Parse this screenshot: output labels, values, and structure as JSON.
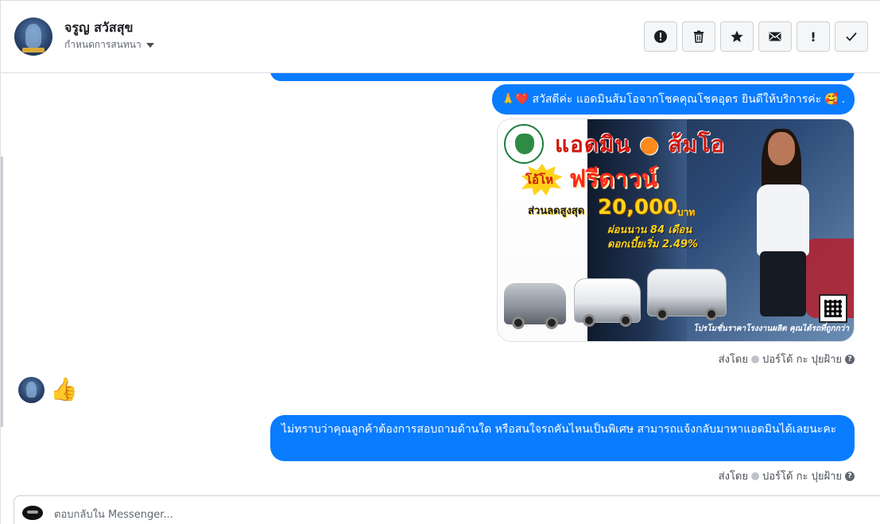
{
  "header": {
    "contact_name": "จรูญ สวัสสุข",
    "assign_label": "กำหนดการสนทนา",
    "actions": [
      {
        "icon": "alert-icon"
      },
      {
        "icon": "trash-icon"
      },
      {
        "icon": "star-icon"
      },
      {
        "icon": "envelope-icon"
      },
      {
        "icon": "exclamation-icon",
        "label": "!"
      },
      {
        "icon": "check-icon"
      }
    ]
  },
  "messages": {
    "greeting": {
      "pre_emojis": "🙏❤️",
      "text": "สวัสดีค่ะ แอดมินส้มโอจากโชคคุณโชคอุดร ยินดีให้บริการค่ะ",
      "post_emoji": "🥰",
      "trail": "."
    },
    "ad": {
      "title_part1": "แอดมิน",
      "title_part2": "ส้มโอ",
      "starburst": "โอ้โห",
      "free_text": "ฟรีดาวน์",
      "discount_label": "ส่วนลดสูงสุด",
      "amount": "20,000",
      "amount_unit": "บาท",
      "installments": "ผ่อนนาน 84 เดือน",
      "interest": "ดอกเบี้ยเริ่ม 2.49%",
      "footer": "โปรโมชั่นราคาโรงงานผลิต คุณได้รถที่ถูกกว่า"
    },
    "sent_by_1": {
      "label": "ส่งโดย",
      "name": "ปอร์โด้ กะ ปุยฝ้าย",
      "help": "?"
    },
    "thumbs_up": "👍",
    "question": "ไม่ทราบว่าคุณลูกค้าต้องการสอบถามด้านใด หรือสนใจรถคันไหนเป็นพิเศษ สามารถแจ้งกลับมาหาแอดมินได้เลยนะคะ",
    "sent_by_2": {
      "label": "ส่งโดย",
      "name": "ปอร์โด้ กะ ปุยฝ้าย",
      "help": "?"
    }
  },
  "composer": {
    "placeholder": "ตอบกลับใน Messenger..."
  },
  "colors": {
    "bubble_blue": "#0a7cff",
    "header_border": "#dddfe2"
  }
}
